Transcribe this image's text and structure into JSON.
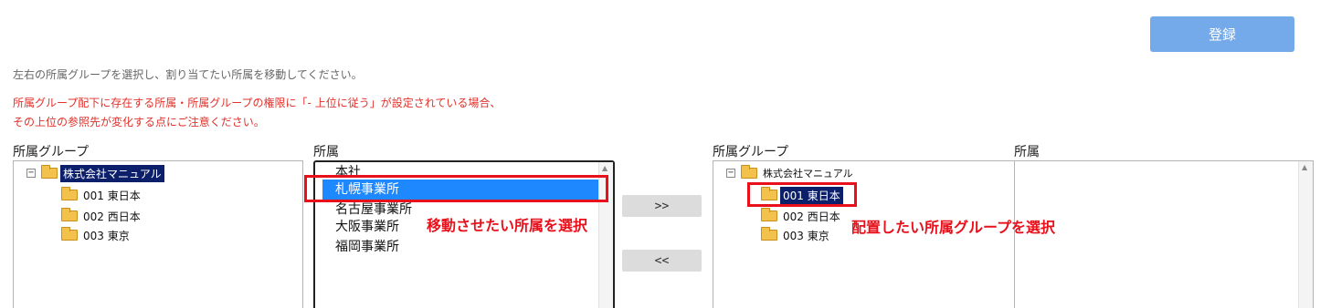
{
  "toolbar": {
    "register_label": "登録"
  },
  "instructions": {
    "main": "左右の所属グループを選択し、割り当てたい所属を移動してください。",
    "warning_line1": "所属グループ配下に存在する所属・所属グループの権限に「- 上位に従う」が設定されている場合、",
    "warning_line2": "その上位の参照先が変化する点にご注意ください。"
  },
  "left_group": {
    "label": "所属グループ",
    "root": {
      "toggle": "−",
      "label": "株式会社マニュアル",
      "selected": true
    },
    "children": [
      "001 東日本",
      "002 西日本",
      "003 東京"
    ]
  },
  "affiliations": {
    "label": "所属",
    "items": [
      "本社",
      "札幌事業所",
      "名古屋事業所",
      "大阪事業所",
      "福岡事業所"
    ],
    "selected_index": 1
  },
  "move_buttons": {
    "to_right": ">>",
    "to_left": "<<"
  },
  "right_group": {
    "label": "所属グループ",
    "root": {
      "toggle": "−",
      "label": "株式会社マニュアル"
    },
    "children": [
      "001 東日本",
      "002 西日本",
      "003 東京"
    ],
    "selected_index": 0
  },
  "right_affiliations": {
    "label": "所属",
    "items": []
  },
  "annotations": {
    "affiliation_hint": "移動させたい所属を選択",
    "group_hint": "配置したい所属グループを選択"
  },
  "colors": {
    "accent": "#74a9ea",
    "selection": "#1e88ff",
    "tree_selection": "#0b1f6b",
    "warning": "#e0312b",
    "highlight": "#e8101b"
  }
}
